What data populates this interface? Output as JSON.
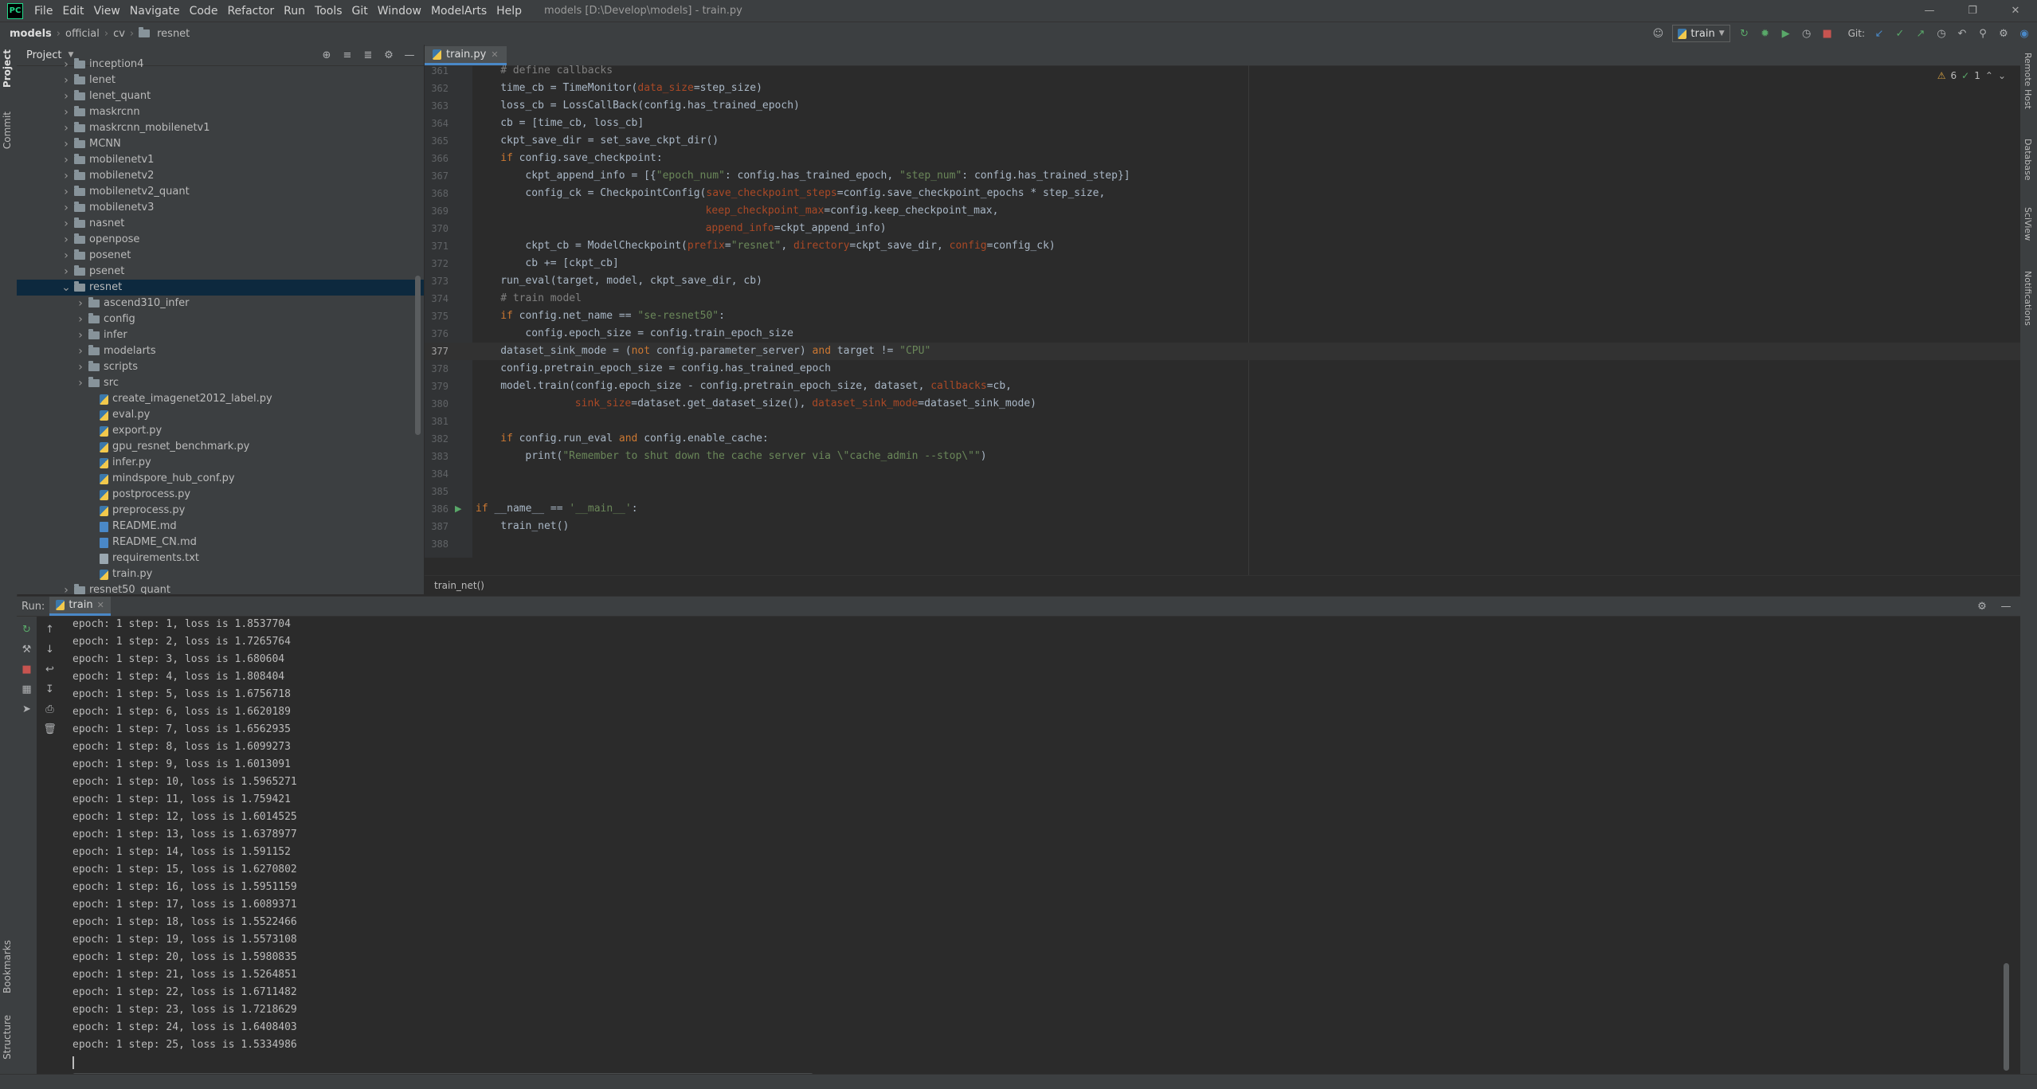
{
  "menubar": {
    "logo": "PC",
    "items": [
      "File",
      "Edit",
      "View",
      "Navigate",
      "Code",
      "Refactor",
      "Run",
      "Tools",
      "Git",
      "Window",
      "ModelArts",
      "Help"
    ],
    "window_title": "models [D:\\Develop\\models] - train.py"
  },
  "navbar": {
    "breadcrumbs": [
      "models",
      "official",
      "cv",
      "resnet"
    ],
    "run_config": "train",
    "git_label": "Git:"
  },
  "left_strip": {
    "tabs": [
      "Project",
      "Commit",
      "Bookmarks",
      "Structure"
    ]
  },
  "right_strip": {
    "tabs": [
      "Remote Host",
      "Database",
      "SciView",
      "Notifications"
    ]
  },
  "project": {
    "title": "Project",
    "tree": [
      {
        "label": "inception4",
        "type": "folder",
        "depth": 1,
        "expanded": false
      },
      {
        "label": "lenet",
        "type": "folder",
        "depth": 1,
        "expanded": false
      },
      {
        "label": "lenet_quant",
        "type": "folder",
        "depth": 1,
        "expanded": false
      },
      {
        "label": "maskrcnn",
        "type": "folder",
        "depth": 1,
        "expanded": false
      },
      {
        "label": "maskrcnn_mobilenetv1",
        "type": "folder",
        "depth": 1,
        "expanded": false
      },
      {
        "label": "MCNN",
        "type": "folder",
        "depth": 1,
        "expanded": false
      },
      {
        "label": "mobilenetv1",
        "type": "folder",
        "depth": 1,
        "expanded": false
      },
      {
        "label": "mobilenetv2",
        "type": "folder",
        "depth": 1,
        "expanded": false
      },
      {
        "label": "mobilenetv2_quant",
        "type": "folder",
        "depth": 1,
        "expanded": false
      },
      {
        "label": "mobilenetv3",
        "type": "folder",
        "depth": 1,
        "expanded": false
      },
      {
        "label": "nasnet",
        "type": "folder",
        "depth": 1,
        "expanded": false
      },
      {
        "label": "openpose",
        "type": "folder",
        "depth": 1,
        "expanded": false
      },
      {
        "label": "posenet",
        "type": "folder",
        "depth": 1,
        "expanded": false
      },
      {
        "label": "psenet",
        "type": "folder",
        "depth": 1,
        "expanded": false
      },
      {
        "label": "resnet",
        "type": "folder",
        "depth": 1,
        "expanded": true,
        "selected": true
      },
      {
        "label": "ascend310_infer",
        "type": "folder",
        "depth": 2,
        "expanded": false
      },
      {
        "label": "config",
        "type": "folder",
        "depth": 2,
        "expanded": false
      },
      {
        "label": "infer",
        "type": "folder",
        "depth": 2,
        "expanded": false
      },
      {
        "label": "modelarts",
        "type": "folder",
        "depth": 2,
        "expanded": false
      },
      {
        "label": "scripts",
        "type": "folder",
        "depth": 2,
        "expanded": false
      },
      {
        "label": "src",
        "type": "folder",
        "depth": 2,
        "expanded": false
      },
      {
        "label": "create_imagenet2012_label.py",
        "type": "py",
        "depth": 2
      },
      {
        "label": "eval.py",
        "type": "py",
        "depth": 2
      },
      {
        "label": "export.py",
        "type": "py",
        "depth": 2
      },
      {
        "label": "gpu_resnet_benchmark.py",
        "type": "py",
        "depth": 2
      },
      {
        "label": "infer.py",
        "type": "py",
        "depth": 2
      },
      {
        "label": "mindspore_hub_conf.py",
        "type": "py",
        "depth": 2
      },
      {
        "label": "postprocess.py",
        "type": "py",
        "depth": 2
      },
      {
        "label": "preprocess.py",
        "type": "py",
        "depth": 2
      },
      {
        "label": "README.md",
        "type": "md",
        "depth": 2
      },
      {
        "label": "README_CN.md",
        "type": "md",
        "depth": 2
      },
      {
        "label": "requirements.txt",
        "type": "txt",
        "depth": 2
      },
      {
        "label": "train.py",
        "type": "py",
        "depth": 2
      },
      {
        "label": "resnet50_quant",
        "type": "folder",
        "depth": 1,
        "expanded": false
      }
    ]
  },
  "editor": {
    "tab": "train.py",
    "inspections": {
      "warnings": "6",
      "ok": "1"
    },
    "current_line": 377,
    "breadcrumb": "train_net()",
    "lines": [
      {
        "n": 361,
        "indent": 4,
        "tokens": [
          [
            "cmt",
            "# define callbacks"
          ]
        ]
      },
      {
        "n": 362,
        "indent": 4,
        "tokens": [
          [
            "",
            "time_cb = TimeMonitor("
          ],
          [
            "param",
            "data_size"
          ],
          [
            "",
            "=step_size)"
          ]
        ]
      },
      {
        "n": 363,
        "indent": 4,
        "tokens": [
          [
            "",
            "loss_cb = LossCallBack(config.has_trained_epoch)"
          ]
        ]
      },
      {
        "n": 364,
        "indent": 4,
        "tokens": [
          [
            "",
            "cb = [time_cb, loss_cb]"
          ]
        ]
      },
      {
        "n": 365,
        "indent": 4,
        "tokens": [
          [
            "",
            "ckpt_save_dir = set_save_ckpt_dir()"
          ]
        ]
      },
      {
        "n": 366,
        "indent": 4,
        "tokens": [
          [
            "kw",
            "if "
          ],
          [
            "",
            "config.save_checkpoint:"
          ]
        ]
      },
      {
        "n": 367,
        "indent": 8,
        "tokens": [
          [
            "",
            "ckpt_append_info = [{"
          ],
          [
            "str",
            "\"epoch_num\""
          ],
          [
            "",
            ": config.has_trained_epoch, "
          ],
          [
            "str",
            "\"step_num\""
          ],
          [
            "",
            ": config.has_trained_step}]"
          ]
        ]
      },
      {
        "n": 368,
        "indent": 8,
        "tokens": [
          [
            "",
            "config_ck = CheckpointConfig("
          ],
          [
            "param",
            "save_checkpoint_steps"
          ],
          [
            "",
            "=config.save_checkpoint_epochs * step_size,"
          ]
        ]
      },
      {
        "n": 369,
        "indent": 37,
        "tokens": [
          [
            "param",
            "keep_checkpoint_max"
          ],
          [
            "",
            "=config.keep_checkpoint_max,"
          ]
        ]
      },
      {
        "n": 370,
        "indent": 37,
        "tokens": [
          [
            "param",
            "append_info"
          ],
          [
            "",
            "=ckpt_append_info)"
          ]
        ]
      },
      {
        "n": 371,
        "indent": 8,
        "tokens": [
          [
            "",
            "ckpt_cb = ModelCheckpoint("
          ],
          [
            "param",
            "prefix"
          ],
          [
            "",
            "="
          ],
          [
            "str",
            "\"resnet\""
          ],
          [
            "",
            ", "
          ],
          [
            "param",
            "directory"
          ],
          [
            "",
            "=ckpt_save_dir, "
          ],
          [
            "param",
            "config"
          ],
          [
            "",
            "=config_ck)"
          ]
        ]
      },
      {
        "n": 372,
        "indent": 8,
        "tokens": [
          [
            "",
            "cb += [ckpt_cb]"
          ]
        ]
      },
      {
        "n": 373,
        "indent": 4,
        "tokens": [
          [
            "",
            "run_eval(target, model, ckpt_save_dir, cb)"
          ]
        ]
      },
      {
        "n": 374,
        "indent": 4,
        "tokens": [
          [
            "cmt",
            "# train model"
          ]
        ]
      },
      {
        "n": 375,
        "indent": 4,
        "tokens": [
          [
            "kw",
            "if "
          ],
          [
            "",
            "config.net_name == "
          ],
          [
            "str",
            "\"se-resnet50\""
          ],
          [
            "",
            ":"
          ]
        ]
      },
      {
        "n": 376,
        "indent": 8,
        "tokens": [
          [
            "",
            "config.epoch_size = config.train_epoch_size"
          ]
        ]
      },
      {
        "n": 377,
        "indent": 4,
        "tokens": [
          [
            "",
            "dataset_sink_mode = ("
          ],
          [
            "kw",
            "not "
          ],
          [
            "",
            "config.parameter_server) "
          ],
          [
            "kw",
            "and "
          ],
          [
            "",
            "target != "
          ],
          [
            "str",
            "\"CPU\""
          ]
        ]
      },
      {
        "n": 378,
        "indent": 4,
        "tokens": [
          [
            "",
            "config.pretrain_epoch_size = config.has_trained_epoch"
          ]
        ]
      },
      {
        "n": 379,
        "indent": 4,
        "tokens": [
          [
            "",
            "model.train(config.epoch_size - config.pretrain_epoch_size, dataset, "
          ],
          [
            "param",
            "callbacks"
          ],
          [
            "",
            "=cb,"
          ]
        ]
      },
      {
        "n": 380,
        "indent": 16,
        "tokens": [
          [
            "param",
            "sink_size"
          ],
          [
            "",
            "=dataset.get_dataset_size(), "
          ],
          [
            "param",
            "dataset_sink_mode"
          ],
          [
            "",
            "=dataset_sink_mode)"
          ]
        ]
      },
      {
        "n": 381,
        "indent": 0,
        "tokens": []
      },
      {
        "n": 382,
        "indent": 4,
        "tokens": [
          [
            "kw",
            "if "
          ],
          [
            "",
            "config.run_eval "
          ],
          [
            "kw",
            "and "
          ],
          [
            "",
            "config.enable_cache:"
          ]
        ]
      },
      {
        "n": 383,
        "indent": 8,
        "tokens": [
          [
            "",
            "print("
          ],
          [
            "str",
            "\"Remember to shut down the cache server via \\\"cache_admin --stop\\\"\""
          ],
          [
            "",
            ")"
          ]
        ]
      },
      {
        "n": 384,
        "indent": 0,
        "tokens": []
      },
      {
        "n": 385,
        "indent": 0,
        "tokens": []
      },
      {
        "n": 386,
        "indent": 0,
        "tokens": [
          [
            "kw",
            "if "
          ],
          [
            "",
            "__name__ == "
          ],
          [
            "str",
            "'__main__'"
          ],
          [
            "",
            ":"
          ]
        ]
      },
      {
        "n": 387,
        "indent": 4,
        "tokens": [
          [
            "",
            "train_net()"
          ]
        ]
      },
      {
        "n": 388,
        "indent": 0,
        "tokens": []
      }
    ]
  },
  "run_panel": {
    "label": "Run:",
    "tab": "train",
    "output": [
      "epoch: 1 step: 1, loss is 1.8537704",
      "epoch: 1 step: 2, loss is 1.7265764",
      "epoch: 1 step: 3, loss is 1.680604",
      "epoch: 1 step: 4, loss is 1.808404",
      "epoch: 1 step: 5, loss is 1.6756718",
      "epoch: 1 step: 6, loss is 1.6620189",
      "epoch: 1 step: 7, loss is 1.6562935",
      "epoch: 1 step: 8, loss is 1.6099273",
      "epoch: 1 step: 9, loss is 1.6013091",
      "epoch: 1 step: 10, loss is 1.5965271",
      "epoch: 1 step: 11, loss is 1.759421",
      "epoch: 1 step: 12, loss is 1.6014525",
      "epoch: 1 step: 13, loss is 1.6378977",
      "epoch: 1 step: 14, loss is 1.591152",
      "epoch: 1 step: 15, loss is 1.6270802",
      "epoch: 1 step: 16, loss is 1.5951159",
      "epoch: 1 step: 17, loss is 1.6089371",
      "epoch: 1 step: 18, loss is 1.5522466",
      "epoch: 1 step: 19, loss is 1.5573108",
      "epoch: 1 step: 20, loss is 1.5980835",
      "epoch: 1 step: 21, loss is 1.5264851",
      "epoch: 1 step: 22, loss is 1.6711482",
      "epoch: 1 step: 23, loss is 1.7218629",
      "epoch: 1 step: 24, loss is 1.6408403",
      "epoch: 1 step: 25, loss is 1.5334986"
    ]
  },
  "colors": {
    "background": "#2b2b2b",
    "panel": "#3c3f41",
    "selection": "#0d293e",
    "keyword": "#cc7832",
    "string": "#6a8759",
    "comment": "#808080",
    "param": "#aa4926",
    "accent": "#4a88c7"
  }
}
